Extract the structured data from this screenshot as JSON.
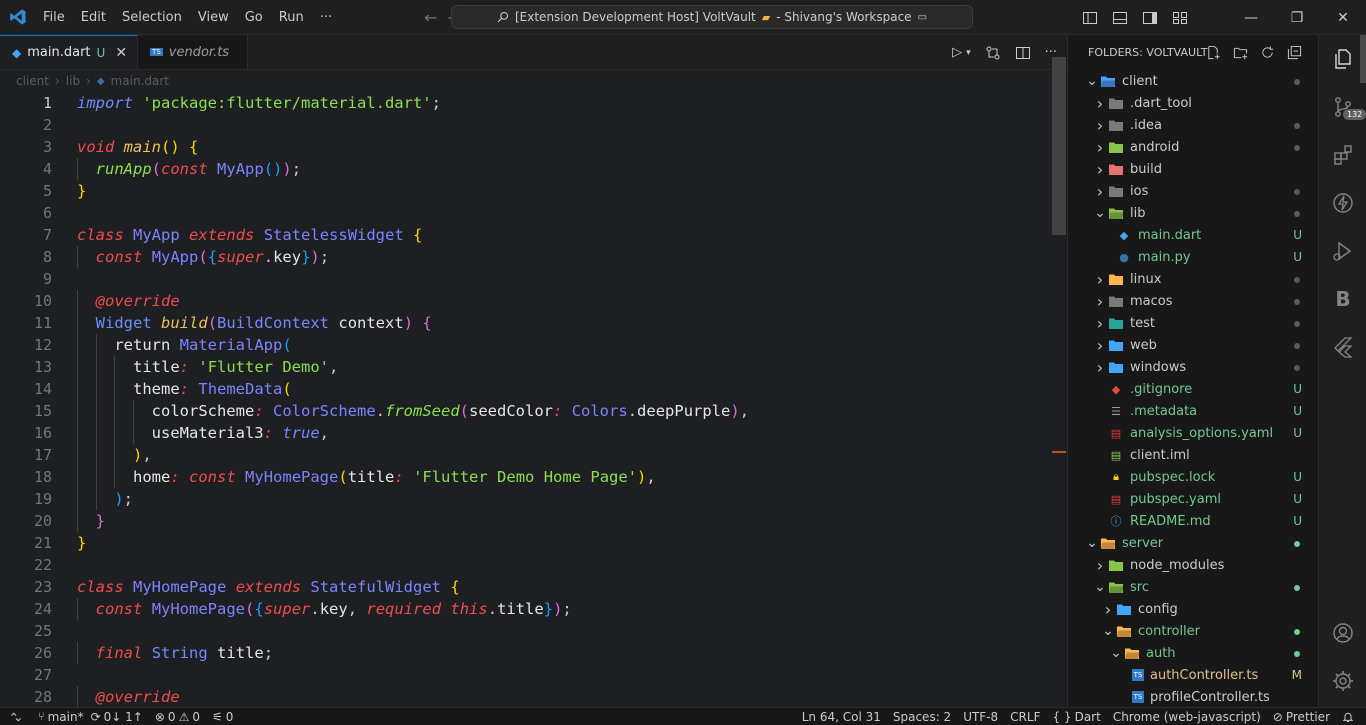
{
  "titlebar": {
    "menu": [
      "File",
      "Edit",
      "Selection",
      "View",
      "Go",
      "Run",
      "···"
    ],
    "command_center": "[Extension Development Host] VoltVault",
    "workspace": "- Shivang's Workspace"
  },
  "tabs": [
    {
      "label": "main.dart",
      "status": "U",
      "active": true
    },
    {
      "label": "vendor.ts",
      "status": "",
      "active": false
    }
  ],
  "breadcrumb": [
    "client",
    "lib",
    "main.dart"
  ],
  "code": {
    "current_line": 1,
    "lines": [
      {
        "n": 1,
        "t": [
          [
            "kw-blue",
            "import"
          ],
          [
            "punc",
            " "
          ],
          [
            "str",
            "'package:flutter/material.dart'"
          ],
          [
            "punc",
            ";"
          ]
        ]
      },
      {
        "n": 2,
        "t": []
      },
      {
        "n": 3,
        "t": [
          [
            "kw-r",
            "void"
          ],
          [
            "punc",
            " "
          ],
          [
            "fn",
            "main"
          ],
          [
            "br-y",
            "()"
          ],
          [
            "punc",
            " "
          ],
          [
            "br-y",
            "{"
          ]
        ]
      },
      {
        "n": 4,
        "t": [
          [
            "punc",
            "  "
          ],
          [
            "fn-g",
            "runApp"
          ],
          [
            "br-p",
            "("
          ],
          [
            "kw-c",
            "const"
          ],
          [
            "punc",
            " "
          ],
          [
            "cls",
            "MyApp"
          ],
          [
            "br-b",
            "()"
          ],
          [
            "br-p",
            ")"
          ],
          [
            "punc",
            ";"
          ]
        ]
      },
      {
        "n": 5,
        "t": [
          [
            "br-y",
            "}"
          ]
        ]
      },
      {
        "n": 6,
        "t": []
      },
      {
        "n": 7,
        "t": [
          [
            "kw-r",
            "class"
          ],
          [
            "punc",
            " "
          ],
          [
            "cls",
            "MyApp"
          ],
          [
            "punc",
            " "
          ],
          [
            "kw-r",
            "extends"
          ],
          [
            "punc",
            " "
          ],
          [
            "cls",
            "StatelessWidget"
          ],
          [
            "punc",
            " "
          ],
          [
            "br-y",
            "{"
          ]
        ]
      },
      {
        "n": 8,
        "t": [
          [
            "punc",
            "  "
          ],
          [
            "kw-c",
            "const"
          ],
          [
            "punc",
            " "
          ],
          [
            "cls",
            "MyApp"
          ],
          [
            "br-p",
            "("
          ],
          [
            "br-b",
            "{"
          ],
          [
            "kw-c",
            "super"
          ],
          [
            "punc",
            "."
          ],
          [
            "prop",
            "key"
          ],
          [
            "br-b",
            "}"
          ],
          [
            "br-p",
            ")"
          ],
          [
            "punc",
            ";"
          ]
        ]
      },
      {
        "n": 9,
        "t": []
      },
      {
        "n": 10,
        "t": [
          [
            "punc",
            "  "
          ],
          [
            "ann",
            "@override"
          ]
        ]
      },
      {
        "n": 11,
        "t": [
          [
            "punc",
            "  "
          ],
          [
            "type-b",
            "Widget"
          ],
          [
            "punc",
            " "
          ],
          [
            "fn",
            "build"
          ],
          [
            "br-p",
            "("
          ],
          [
            "cls",
            "BuildContext"
          ],
          [
            "punc",
            " "
          ],
          [
            "prop",
            "context"
          ],
          [
            "br-p",
            ")"
          ],
          [
            "punc",
            " "
          ],
          [
            "br-p",
            "{"
          ]
        ]
      },
      {
        "n": 12,
        "t": [
          [
            "punc",
            "    "
          ],
          [
            "prop",
            "return"
          ],
          [
            "punc",
            " "
          ],
          [
            "cls",
            "MaterialApp"
          ],
          [
            "br-b",
            "("
          ]
        ]
      },
      {
        "n": 13,
        "t": [
          [
            "punc",
            "      "
          ],
          [
            "prop",
            "title"
          ],
          [
            "kw-c",
            ":"
          ],
          [
            "punc",
            " "
          ],
          [
            "str",
            "'Flutter Demo'"
          ],
          [
            "punc",
            ","
          ]
        ]
      },
      {
        "n": 14,
        "t": [
          [
            "punc",
            "      "
          ],
          [
            "prop",
            "theme"
          ],
          [
            "kw-c",
            ":"
          ],
          [
            "punc",
            " "
          ],
          [
            "cls",
            "ThemeData"
          ],
          [
            "br-y",
            "("
          ]
        ]
      },
      {
        "n": 15,
        "t": [
          [
            "punc",
            "        "
          ],
          [
            "prop",
            "colorScheme"
          ],
          [
            "kw-c",
            ":"
          ],
          [
            "punc",
            " "
          ],
          [
            "cls",
            "ColorScheme"
          ],
          [
            "punc",
            "."
          ],
          [
            "fn-g",
            "fromSeed"
          ],
          [
            "br-p",
            "("
          ],
          [
            "prop",
            "seedColor"
          ],
          [
            "kw-c",
            ":"
          ],
          [
            "punc",
            " "
          ],
          [
            "cls",
            "Colors"
          ],
          [
            "punc",
            "."
          ],
          [
            "prop",
            "deepPurple"
          ],
          [
            "br-p",
            ")"
          ],
          [
            "punc",
            ","
          ]
        ]
      },
      {
        "n": 16,
        "t": [
          [
            "punc",
            "        "
          ],
          [
            "prop",
            "useMaterial3"
          ],
          [
            "kw-c",
            ":"
          ],
          [
            "punc",
            " "
          ],
          [
            "bool",
            "true"
          ],
          [
            "punc",
            ","
          ]
        ]
      },
      {
        "n": 17,
        "t": [
          [
            "punc",
            "      "
          ],
          [
            "br-y",
            ")"
          ],
          [
            "punc",
            ","
          ]
        ]
      },
      {
        "n": 18,
        "t": [
          [
            "punc",
            "      "
          ],
          [
            "prop",
            "home"
          ],
          [
            "kw-c",
            ":"
          ],
          [
            "punc",
            " "
          ],
          [
            "kw-c",
            "const"
          ],
          [
            "punc",
            " "
          ],
          [
            "cls",
            "MyHomePage"
          ],
          [
            "br-y",
            "("
          ],
          [
            "prop",
            "title"
          ],
          [
            "kw-c",
            ":"
          ],
          [
            "punc",
            " "
          ],
          [
            "str",
            "'Flutter Demo Home Page'"
          ],
          [
            "br-y",
            ")"
          ],
          [
            "punc",
            ","
          ]
        ]
      },
      {
        "n": 19,
        "t": [
          [
            "punc",
            "    "
          ],
          [
            "br-b",
            ")"
          ],
          [
            "punc",
            ";"
          ]
        ]
      },
      {
        "n": 20,
        "t": [
          [
            "punc",
            "  "
          ],
          [
            "br-p",
            "}"
          ]
        ]
      },
      {
        "n": 21,
        "t": [
          [
            "br-y",
            "}"
          ]
        ]
      },
      {
        "n": 22,
        "t": []
      },
      {
        "n": 23,
        "t": [
          [
            "kw-r",
            "class"
          ],
          [
            "punc",
            " "
          ],
          [
            "cls",
            "MyHomePage"
          ],
          [
            "punc",
            " "
          ],
          [
            "kw-r",
            "extends"
          ],
          [
            "punc",
            " "
          ],
          [
            "cls",
            "StatefulWidget"
          ],
          [
            "punc",
            " "
          ],
          [
            "br-y",
            "{"
          ]
        ]
      },
      {
        "n": 24,
        "t": [
          [
            "punc",
            "  "
          ],
          [
            "kw-c",
            "const"
          ],
          [
            "punc",
            " "
          ],
          [
            "cls",
            "MyHomePage"
          ],
          [
            "br-p",
            "("
          ],
          [
            "br-b",
            "{"
          ],
          [
            "kw-c",
            "super"
          ],
          [
            "punc",
            "."
          ],
          [
            "prop",
            "key"
          ],
          [
            "punc",
            ", "
          ],
          [
            "kw-c",
            "required"
          ],
          [
            "punc",
            " "
          ],
          [
            "kw-c",
            "this"
          ],
          [
            "punc",
            "."
          ],
          [
            "prop",
            "title"
          ],
          [
            "br-b",
            "}"
          ],
          [
            "br-p",
            ")"
          ],
          [
            "punc",
            ";"
          ]
        ]
      },
      {
        "n": 25,
        "t": []
      },
      {
        "n": 26,
        "t": [
          [
            "punc",
            "  "
          ],
          [
            "kw-c",
            "final"
          ],
          [
            "punc",
            " "
          ],
          [
            "type-b",
            "String"
          ],
          [
            "punc",
            " "
          ],
          [
            "prop",
            "title"
          ],
          [
            "punc",
            ";"
          ]
        ]
      },
      {
        "n": 27,
        "t": []
      },
      {
        "n": 28,
        "t": [
          [
            "punc",
            "  "
          ],
          [
            "ann",
            "@override"
          ]
        ]
      }
    ]
  },
  "explorer": {
    "title": "FOLDERS: VOLTVAULT",
    "items": [
      {
        "depth": 0,
        "chev": "v",
        "icon": "folder-open",
        "color": "#4a9eff",
        "label": "client",
        "status": "dot"
      },
      {
        "depth": 1,
        "chev": ">",
        "icon": "folder",
        "color": "#7a7a7a",
        "label": ".dart_tool",
        "status": ""
      },
      {
        "depth": 1,
        "chev": ">",
        "icon": "folder",
        "color": "#7a7a7a",
        "label": ".idea",
        "status": "dot"
      },
      {
        "depth": 1,
        "chev": ">",
        "icon": "folder",
        "color": "#8bc34a",
        "label": "android",
        "status": "dot"
      },
      {
        "depth": 1,
        "chev": ">",
        "icon": "folder",
        "color": "#e57373",
        "label": "build",
        "status": ""
      },
      {
        "depth": 1,
        "chev": ">",
        "icon": "folder",
        "color": "#7a7a7a",
        "label": "ios",
        "status": "dot"
      },
      {
        "depth": 1,
        "chev": "v",
        "icon": "folder-open",
        "color": "#8bc34a",
        "label": "lib",
        "status": "dot"
      },
      {
        "depth": 2,
        "chev": "",
        "icon": "dart",
        "color": "#42a5f5",
        "label": "main.dart",
        "status": "U"
      },
      {
        "depth": 2,
        "chev": "",
        "icon": "python",
        "color": "#3572a5",
        "label": "main.py",
        "status": "U"
      },
      {
        "depth": 1,
        "chev": ">",
        "icon": "folder",
        "color": "#ffb74d",
        "label": "linux",
        "status": "dot"
      },
      {
        "depth": 1,
        "chev": ">",
        "icon": "folder",
        "color": "#7a7a7a",
        "label": "macos",
        "status": "dot"
      },
      {
        "depth": 1,
        "chev": ">",
        "icon": "folder",
        "color": "#26a69a",
        "label": "test",
        "status": "dot"
      },
      {
        "depth": 1,
        "chev": ">",
        "icon": "folder",
        "color": "#42a5f5",
        "label": "web",
        "status": "dot"
      },
      {
        "depth": 1,
        "chev": ">",
        "icon": "folder",
        "color": "#42a5f5",
        "label": "windows",
        "status": "dot"
      },
      {
        "depth": 1,
        "chev": "",
        "icon": "git",
        "color": "#e84d31",
        "label": ".gitignore",
        "status": "U"
      },
      {
        "depth": 1,
        "chev": "",
        "icon": "file",
        "color": "#9e9e9e",
        "label": ".metadata",
        "status": "U"
      },
      {
        "depth": 1,
        "chev": "",
        "icon": "yaml",
        "color": "#e53935",
        "label": "analysis_options.yaml",
        "status": "U"
      },
      {
        "depth": 1,
        "chev": "",
        "icon": "iml",
        "color": "#8bc34a",
        "label": "client.iml",
        "status": ""
      },
      {
        "depth": 1,
        "chev": "",
        "icon": "lock",
        "color": "#ffca28",
        "label": "pubspec.lock",
        "status": "U"
      },
      {
        "depth": 1,
        "chev": "",
        "icon": "yaml",
        "color": "#e53935",
        "label": "pubspec.yaml",
        "status": "U"
      },
      {
        "depth": 1,
        "chev": "",
        "icon": "info",
        "color": "#42a5f5",
        "label": "README.md",
        "status": "U"
      },
      {
        "depth": 0,
        "chev": "v",
        "icon": "folder-open",
        "color": "#ffb74d",
        "label": "server",
        "status": "green"
      },
      {
        "depth": 1,
        "chev": ">",
        "icon": "folder",
        "color": "#8bc34a",
        "label": "node_modules",
        "status": ""
      },
      {
        "depth": 1,
        "chev": "v",
        "icon": "folder-open",
        "color": "#8bc34a",
        "label": "src",
        "status": "green"
      },
      {
        "depth": 2,
        "chev": ">",
        "icon": "folder",
        "color": "#42a5f5",
        "label": "config",
        "status": ""
      },
      {
        "depth": 2,
        "chev": "v",
        "icon": "folder-open",
        "color": "#ffb74d",
        "label": "controller",
        "status": "green"
      },
      {
        "depth": 3,
        "chev": "v",
        "icon": "folder-open",
        "color": "#ffb74d",
        "label": "auth",
        "status": "green"
      },
      {
        "depth": 4,
        "chev": "",
        "icon": "ts",
        "color": "#3178c6",
        "label": "authController.ts",
        "status": "M"
      },
      {
        "depth": 4,
        "chev": "",
        "icon": "ts",
        "color": "#3178c6",
        "label": "profileController.ts",
        "status": ""
      }
    ]
  },
  "activity": {
    "scm_badge": "132"
  },
  "statusbar": {
    "branch": "main*",
    "sync": "0↓ 1↑",
    "errors": "0",
    "warnings": "0",
    "ports": "0",
    "position": "Ln 64, Col 31",
    "spaces": "Spaces: 2",
    "encoding": "UTF-8",
    "eol": "CRLF",
    "language": "Dart",
    "browser": "Chrome (web-javascript)",
    "formatter": "Prettier"
  }
}
